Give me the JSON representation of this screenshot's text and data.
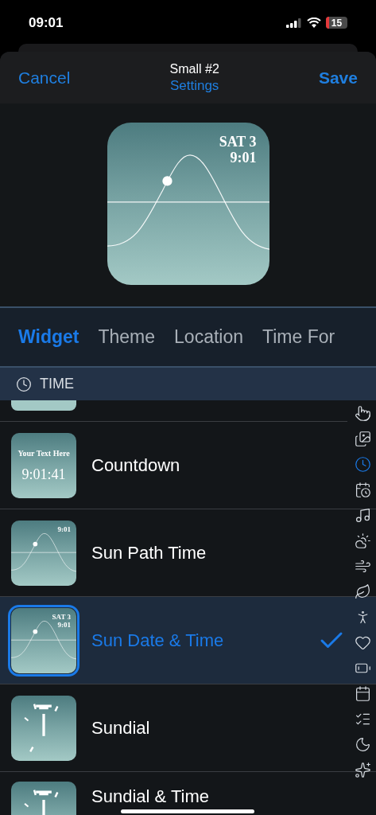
{
  "status_bar": {
    "time": "09:01",
    "battery": "15"
  },
  "nav": {
    "cancel": "Cancel",
    "title": "Small #2",
    "subtitle": "Settings",
    "save": "Save"
  },
  "preview": {
    "kind": "sun_path",
    "lines": [
      "SAT 3",
      "9:01"
    ]
  },
  "tabs": [
    {
      "label": "Widget",
      "selected": true
    },
    {
      "label": "Theme",
      "selected": false
    },
    {
      "label": "Location",
      "selected": false
    },
    {
      "label": "Time For",
      "selected": false
    }
  ],
  "section": {
    "title": "TIME"
  },
  "widgets": [
    {
      "name": "Countdown",
      "kind": "countdown",
      "thumb_text": [
        "Your Text Here",
        "9:01:41"
      ],
      "selected": false
    },
    {
      "name": "Sun Path Time",
      "kind": "sun_path",
      "thumb_text": [
        "9:01"
      ],
      "selected": false
    },
    {
      "name": "Sun Date & Time",
      "kind": "sun_path",
      "thumb_text": [
        "SAT 3",
        "9:01"
      ],
      "selected": true
    },
    {
      "name": "Sundial",
      "kind": "sundial",
      "selected": false
    },
    {
      "name": "Sundial & Time",
      "kind": "sundial",
      "selected": false
    }
  ],
  "index": [
    {
      "selected": false
    },
    {
      "selected": false
    },
    {
      "selected": true
    },
    {
      "selected": false
    },
    {
      "selected": false
    },
    {
      "selected": false
    },
    {
      "selected": false
    },
    {
      "selected": false
    },
    {
      "selected": false
    },
    {
      "selected": false
    },
    {
      "selected": false
    },
    {
      "selected": false
    },
    {
      "selected": false
    },
    {
      "selected": false
    },
    {
      "selected": false
    }
  ]
}
